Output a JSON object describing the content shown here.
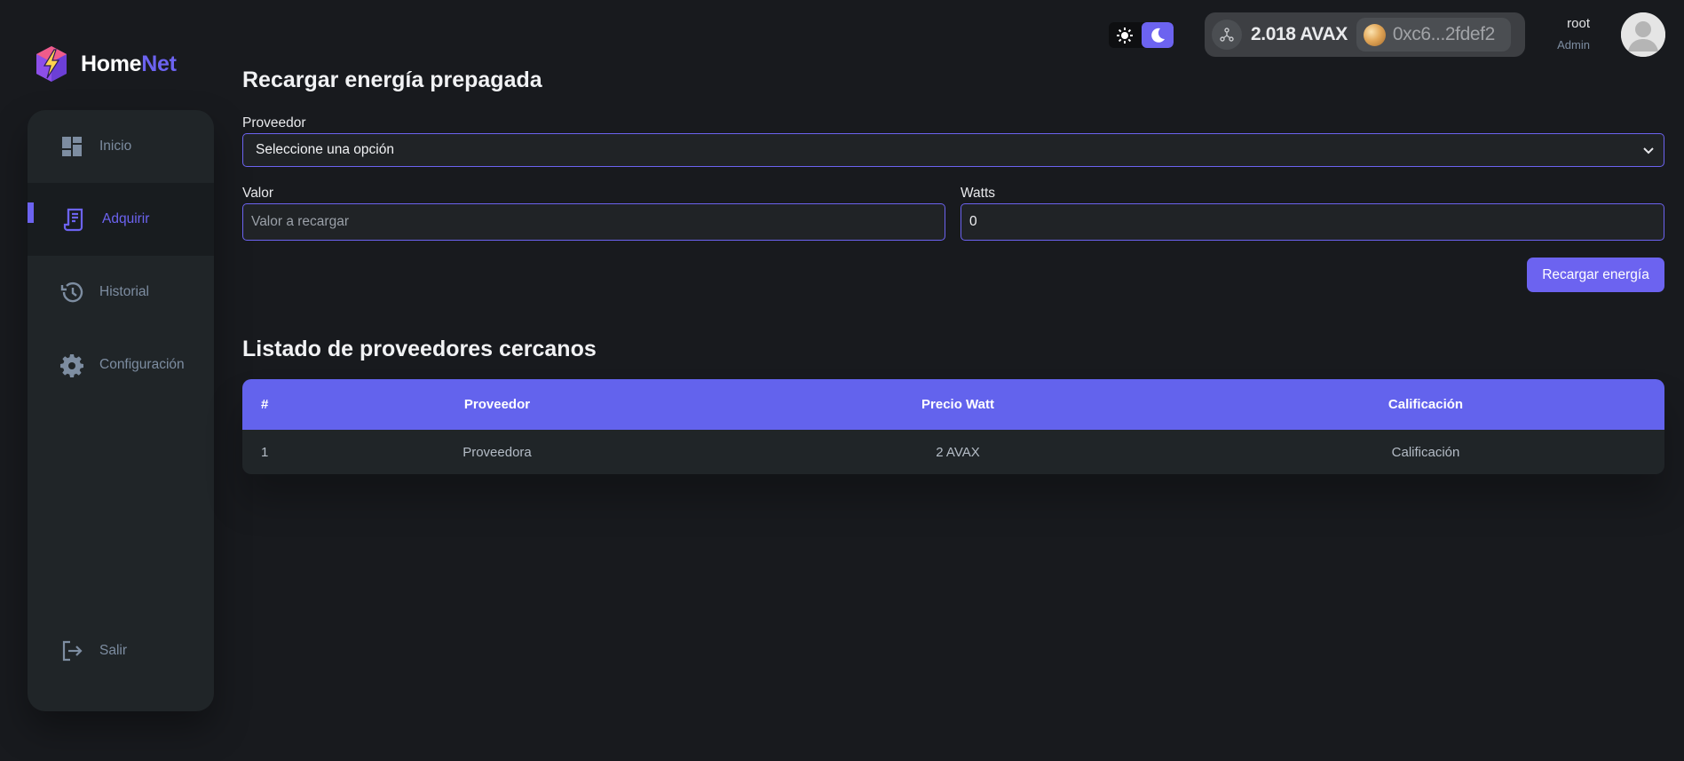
{
  "app": {
    "logo_part1": "Home",
    "logo_part2": "Net",
    "accent_color": "#6c63f0"
  },
  "sidebar": {
    "items": [
      {
        "label": "Inicio",
        "icon": "dashboard-icon",
        "active": false
      },
      {
        "label": "Adquirir",
        "icon": "receipt-icon",
        "active": true
      },
      {
        "label": "Historial",
        "icon": "history-icon",
        "active": false
      },
      {
        "label": "Configuración",
        "icon": "gear-icon",
        "active": false
      },
      {
        "label": "Salir",
        "icon": "logout-icon",
        "active": false
      }
    ]
  },
  "header": {
    "theme": {
      "light_icon": "sun-icon",
      "dark_icon": "moon-icon",
      "selected": "dark"
    },
    "wallet": {
      "network_icon": "network-icon",
      "balance": "2.018 AVAX",
      "address": "0xc6...2fdef2"
    },
    "user": {
      "name": "root",
      "role": "Admin"
    }
  },
  "form": {
    "title": "Recargar energía prepagada",
    "provider_label": "Proveedor",
    "provider_selected": "Seleccione una opción",
    "value_label": "Valor",
    "value_placeholder": "Valor a recargar",
    "watts_label": "Watts",
    "watts_value": "0",
    "submit_label": "Recargar energía"
  },
  "providers": {
    "title": "Listado de proveedores cercanos",
    "columns": [
      "#",
      "Proveedor",
      "Precio Watt",
      "Calificación"
    ],
    "rows": [
      [
        "1",
        "Proveedora",
        "2 AVAX",
        "Calificación"
      ]
    ]
  }
}
